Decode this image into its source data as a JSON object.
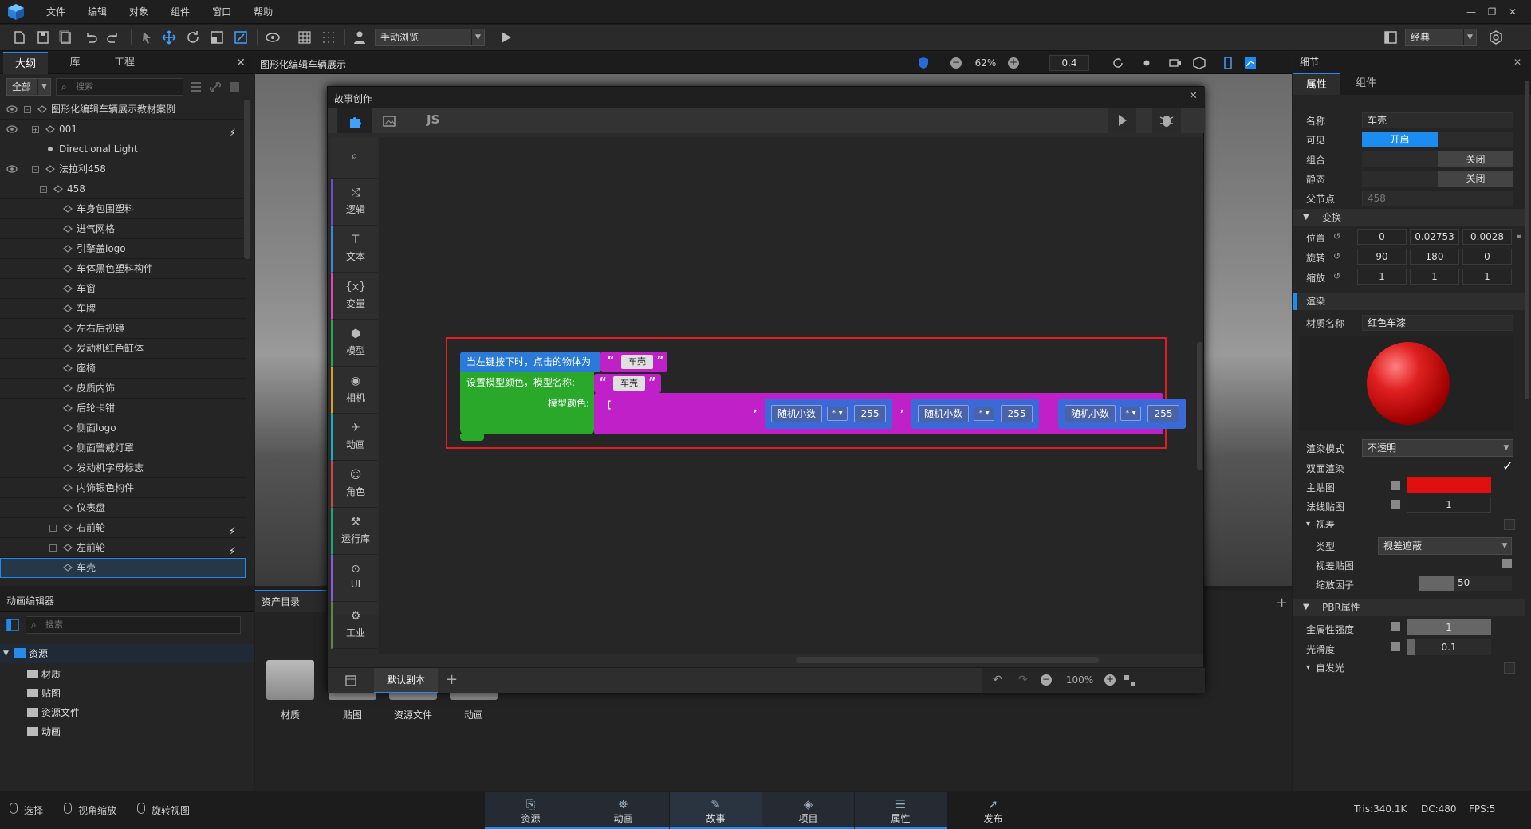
{
  "menubar": {
    "items": [
      "文件",
      "编辑",
      "对象",
      "组件",
      "窗口",
      "帮助"
    ]
  },
  "toolbar": {
    "browse_mode": "手动浏览",
    "layout_mode": "经典"
  },
  "left_panel": {
    "tabs": [
      "大纲",
      "库",
      "工程"
    ],
    "filter": "全部",
    "search_placeholder": "搜索",
    "tree": [
      {
        "label": "图形化编辑车辆展示教材案例",
        "depth": 0,
        "expand": "-",
        "eye": true
      },
      {
        "label": "001",
        "depth": 1,
        "expand": "+",
        "eye": true,
        "run": true
      },
      {
        "label": "Directional Light",
        "depth": 1,
        "expand": "",
        "eye": false,
        "light": true
      },
      {
        "label": "法拉利458",
        "depth": 1,
        "expand": "-",
        "eye": true
      },
      {
        "label": "458",
        "depth": 2,
        "expand": "-",
        "eye": false
      },
      {
        "label": "车身包围塑料",
        "depth": 3,
        "expand": "",
        "eye": false
      },
      {
        "label": "进气网格",
        "depth": 3,
        "expand": "",
        "eye": false
      },
      {
        "label": "引擎盖logo",
        "depth": 3,
        "expand": "",
        "eye": false
      },
      {
        "label": "车体黑色塑料构件",
        "depth": 3,
        "expand": "",
        "eye": false
      },
      {
        "label": "车窗",
        "depth": 3,
        "expand": "",
        "eye": false
      },
      {
        "label": "车牌",
        "depth": 3,
        "expand": "",
        "eye": false
      },
      {
        "label": "左右后视镜",
        "depth": 3,
        "expand": "",
        "eye": false
      },
      {
        "label": "发动机红色缸体",
        "depth": 3,
        "expand": "",
        "eye": false
      },
      {
        "label": "座椅",
        "depth": 3,
        "expand": "",
        "eye": false
      },
      {
        "label": "皮质内饰",
        "depth": 3,
        "expand": "",
        "eye": false
      },
      {
        "label": "后轮卡钳",
        "depth": 3,
        "expand": "",
        "eye": false
      },
      {
        "label": "侧面logo",
        "depth": 3,
        "expand": "",
        "eye": false
      },
      {
        "label": "侧面警戒灯罩",
        "depth": 3,
        "expand": "",
        "eye": false
      },
      {
        "label": "发动机字母标志",
        "depth": 3,
        "expand": "",
        "eye": false
      },
      {
        "label": "内饰银色构件",
        "depth": 3,
        "expand": "",
        "eye": false
      },
      {
        "label": "仪表盘",
        "depth": 3,
        "expand": "",
        "eye": false
      },
      {
        "label": "右前轮",
        "depth": 3,
        "expand": "+",
        "eye": false,
        "run": true
      },
      {
        "label": "左前轮",
        "depth": 3,
        "expand": "+",
        "eye": false,
        "run": true
      },
      {
        "label": "车壳",
        "depth": 3,
        "expand": "",
        "eye": false,
        "selected": true
      }
    ]
  },
  "anim_editor": {
    "title": "动画编辑器",
    "search_placeholder": "搜索",
    "root": "资源",
    "folders": [
      "材质",
      "贴图",
      "资源文件",
      "动画"
    ]
  },
  "viewport": {
    "tab_title": "图形化编辑车辆展示",
    "zoom": "62%",
    "speed": "0.4"
  },
  "assets": {
    "title": "资产目录",
    "items": [
      "材质",
      "贴图",
      "资源文件",
      "动画"
    ]
  },
  "story": {
    "title": "故事创作",
    "js_tab": "JS",
    "categories": [
      "逻辑",
      "文本",
      "变量",
      "模型",
      "相机",
      "动画",
      "角色",
      "运行库",
      "UI",
      "工业"
    ],
    "category_colors": [
      "#6a4fc8",
      "#3a8ad8",
      "#d84ab0",
      "#2aa84a",
      "#d8a02a",
      "#1ab0c8",
      "#c84a4a",
      "#1aa878",
      "#8a5ad8",
      "#5a8a3a"
    ],
    "blocks": {
      "event_label": "当左键按下时，点击的物体为",
      "event_value": "车壳",
      "action_label1": "设置模型颜色，模型名称:",
      "action_value": "车壳",
      "action_label2": "模型颜色:",
      "random_label": "随机小数",
      "mul_op": "* ▾",
      "num": "255"
    },
    "script_tab": "默认剧本",
    "zoom": "100%"
  },
  "details": {
    "title": "细节",
    "tabs": [
      "属性",
      "组件"
    ],
    "name_label": "名称",
    "name_value": "车壳",
    "visible_label": "可见",
    "visible_value": "开启",
    "group_label": "组合",
    "group_value": "关闭",
    "static_label": "静态",
    "static_value": "关闭",
    "parent_label": "父节点",
    "parent_value": "458",
    "transform_title": "变换",
    "pos_label": "位置",
    "pos": [
      "0",
      "0.02753",
      "0.0028"
    ],
    "rot_label": "旋转",
    "rot": [
      "90",
      "180",
      "0"
    ],
    "scale_label": "缩放",
    "scale": [
      "1",
      "1",
      "1"
    ],
    "render_title": "渲染",
    "material_label": "材质名称",
    "material_value": "红色车漆",
    "render_mode_label": "渲染模式",
    "render_mode_value": "不透明",
    "double_side_label": "双面渲染",
    "main_tex_label": "主贴图",
    "main_color": "#e01010",
    "normal_tex_label": "法线贴图",
    "normal_value": "1",
    "parallax_title": "视差",
    "type_label": "类型",
    "type_value": "视差遮蔽",
    "parallax_tex_label": "视差贴图",
    "scale_factor_label": "缩放因子",
    "scale_factor_value": "50",
    "pbr_title": "PBR属性",
    "metal_label": "金属性强度",
    "metal_value": "1",
    "smooth_label": "光滑度",
    "smooth_value": "0.1",
    "emissive_title": "自发光"
  },
  "statusbar": {
    "tools": [
      "选择",
      "视角缩放",
      "旋转视图"
    ],
    "nav": [
      "资源",
      "动画",
      "故事",
      "项目",
      "属性",
      "发布"
    ],
    "stats": {
      "tris": "Tris:340.1K",
      "dc": "DC:480",
      "fps": "FPS:5"
    }
  }
}
